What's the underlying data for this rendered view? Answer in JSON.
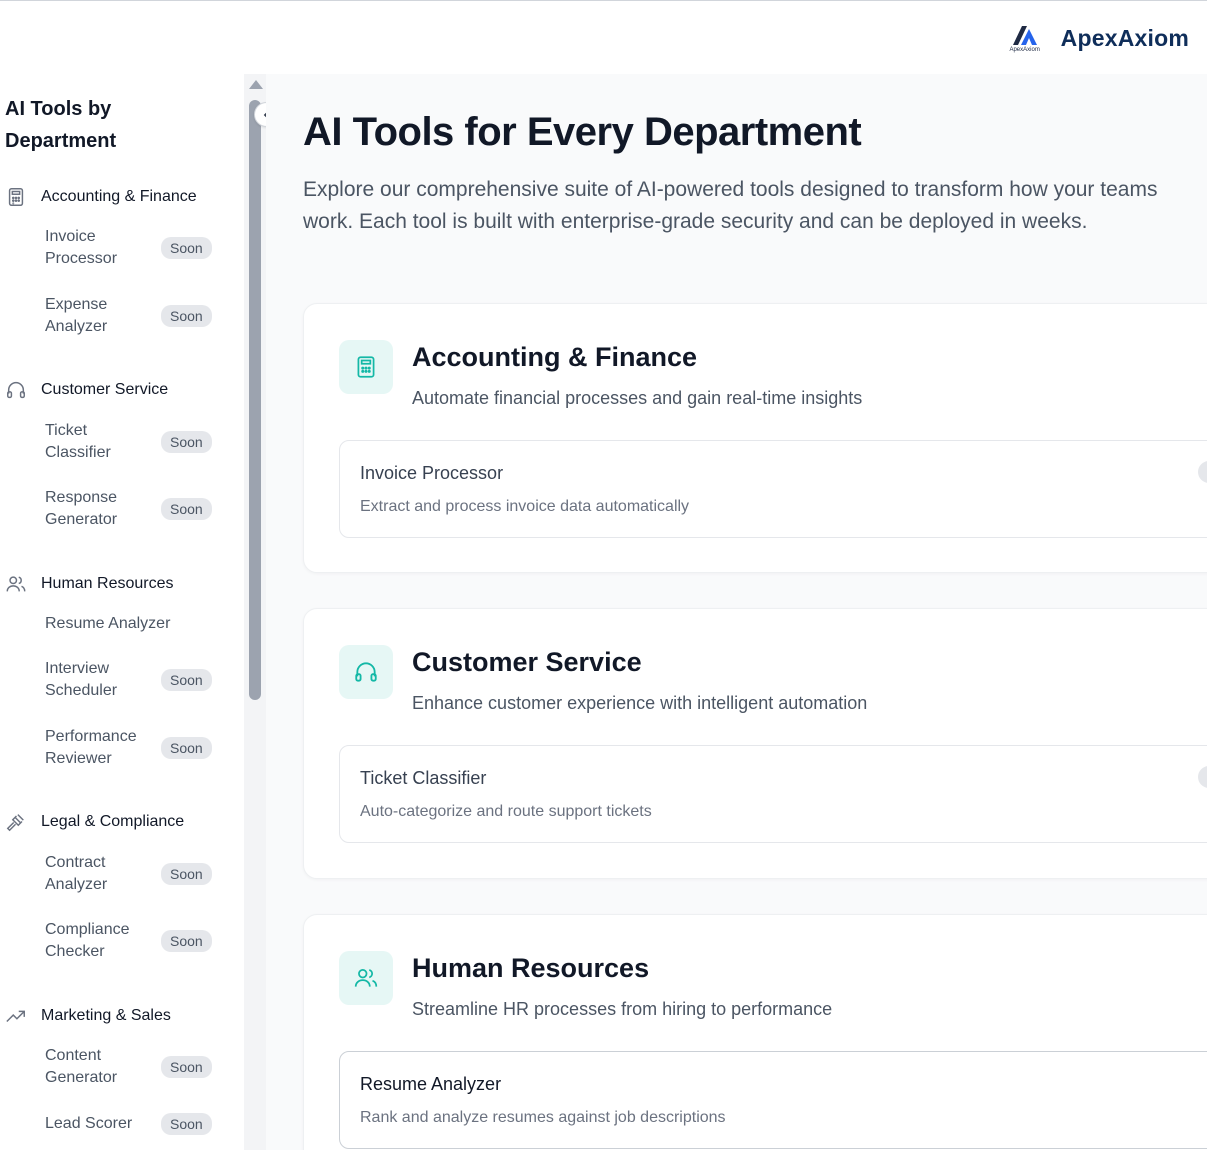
{
  "header": {
    "brand_name": "ApexAxiom",
    "logo_text": "ApexAxiom"
  },
  "sidebar": {
    "title": "AI Tools by Department",
    "badge_label": "Soon",
    "sections": [
      {
        "name": "Accounting & Finance",
        "icon": "calculator-icon",
        "items": [
          {
            "label": "Invoice Processor",
            "badge": "Soon"
          },
          {
            "label": "Expense Analyzer",
            "badge": "Soon"
          }
        ]
      },
      {
        "name": "Customer Service",
        "icon": "headphones-icon",
        "items": [
          {
            "label": "Ticket Classifier",
            "badge": "Soon"
          },
          {
            "label": "Response Generator",
            "badge": "Soon"
          }
        ]
      },
      {
        "name": "Human Resources",
        "icon": "users-icon",
        "items": [
          {
            "label": "Resume Analyzer",
            "badge": ""
          },
          {
            "label": "Interview Scheduler",
            "badge": "Soon"
          },
          {
            "label": "Performance Reviewer",
            "badge": "Soon"
          }
        ]
      },
      {
        "name": "Legal & Compliance",
        "icon": "gavel-icon",
        "items": [
          {
            "label": "Contract Analyzer",
            "badge": "Soon"
          },
          {
            "label": "Compliance Checker",
            "badge": "Soon"
          }
        ]
      },
      {
        "name": "Marketing & Sales",
        "icon": "trending-up-icon",
        "items": [
          {
            "label": "Content Generator",
            "badge": "Soon"
          },
          {
            "label": "Lead Scorer",
            "badge": "Soon"
          }
        ]
      }
    ]
  },
  "main": {
    "title": "AI Tools for Every Department",
    "intro": "Explore our comprehensive suite of AI-powered tools designed to transform how your teams work. Each tool is built with enterprise-grade security and can be deployed in weeks.",
    "cards": [
      {
        "title": "Accounting & Finance",
        "desc": "Automate financial processes and gain real-time insights",
        "icon": "calculator-icon",
        "tool": {
          "name": "Invoice Processor",
          "desc": "Extract and process invoice data automatically"
        }
      },
      {
        "title": "Customer Service",
        "desc": "Enhance customer experience with intelligent automation",
        "icon": "headphones-icon",
        "tool": {
          "name": "Ticket Classifier",
          "desc": "Auto-categorize and route support tickets"
        }
      },
      {
        "title": "Human Resources",
        "desc": "Streamline HR processes from hiring to performance",
        "icon": "users-icon",
        "tool": {
          "name": "Resume Analyzer",
          "desc": "Rank and analyze resumes against job descriptions"
        }
      }
    ]
  },
  "colors": {
    "accent": "#14b8a6",
    "brand": "#0f2e5a",
    "badge_bg": "#e5e7eb"
  }
}
